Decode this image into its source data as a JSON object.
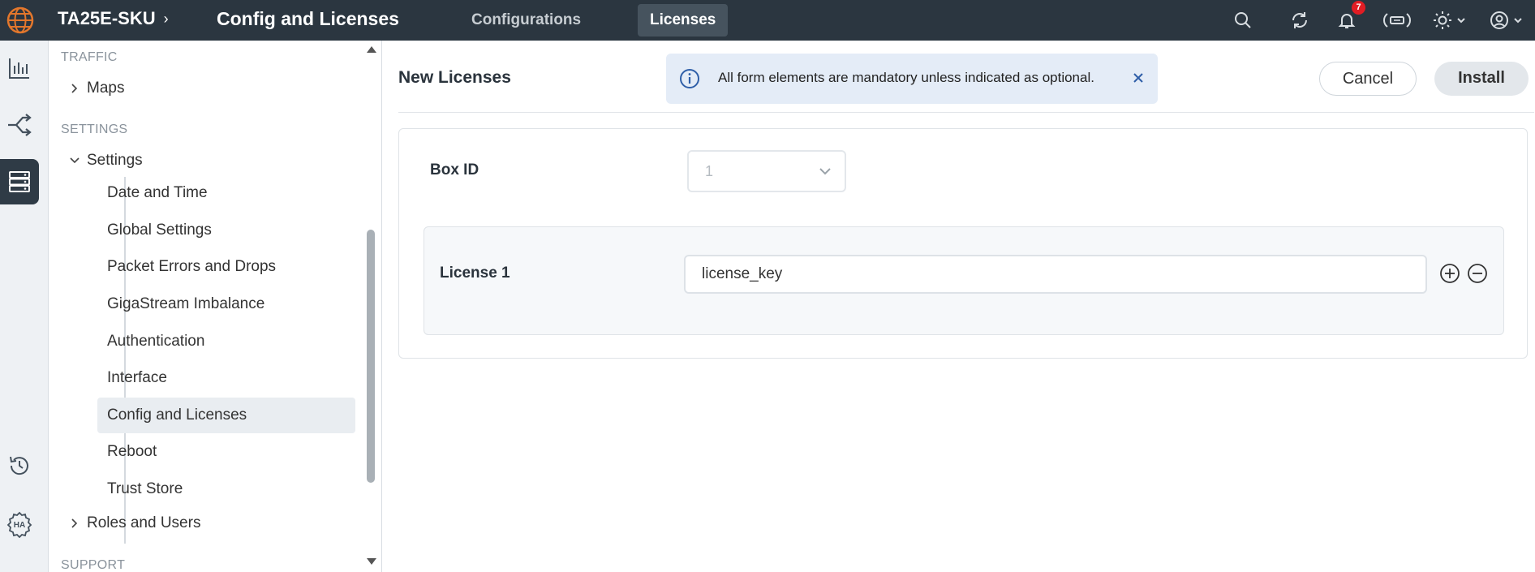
{
  "header": {
    "device_name": "TA25E-SKU",
    "page_title": "Config and Licenses",
    "tabs": [
      {
        "label": "Configurations",
        "active": false
      },
      {
        "label": "Licenses",
        "active": true
      }
    ],
    "notification_count": "7"
  },
  "sidebar": {
    "sections": [
      {
        "heading": "TRAFFIC"
      },
      {
        "heading": "SETTINGS"
      },
      {
        "heading": "SUPPORT"
      }
    ],
    "groups": {
      "maps": "Maps",
      "settings": "Settings",
      "roles": "Roles and Users"
    },
    "settings_items": [
      {
        "label": "Date and Time"
      },
      {
        "label": "Global Settings"
      },
      {
        "label": "Packet Errors and Drops"
      },
      {
        "label": "GigaStream Imbalance"
      },
      {
        "label": "Authentication"
      },
      {
        "label": "Interface"
      },
      {
        "label": "Config and Licenses"
      },
      {
        "label": "Reboot"
      },
      {
        "label": "Trust Store"
      }
    ],
    "active_item": "Config and Licenses"
  },
  "main": {
    "title": "New Licenses",
    "banner_message": "All form elements are mandatory unless indicated as optional.",
    "cancel_label": "Cancel",
    "install_label": "Install",
    "box_id_label": "Box ID",
    "box_id_value": "1",
    "license_label": "License 1",
    "license_value": "license_key"
  },
  "rail_icons": [
    "chart-icon",
    "flow-icon",
    "server-icon",
    "history-icon",
    "ha-icon"
  ],
  "colors": {
    "topbar": "#2b3640",
    "active_rail": "#2f3b46",
    "banner": "#e4ecf7",
    "badge": "#e11d24",
    "logo": "#e3772c"
  }
}
